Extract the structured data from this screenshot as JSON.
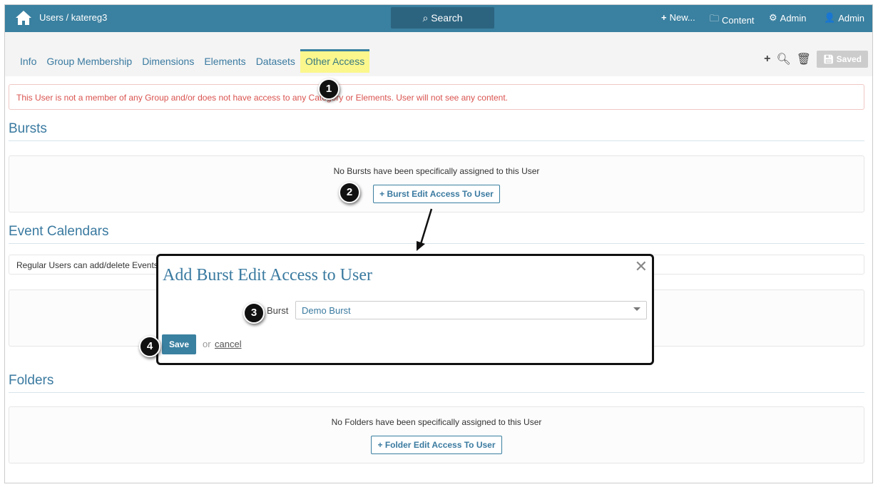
{
  "topbar": {
    "breadcrumb": "Users / katereg3",
    "search": "Search",
    "new": "New...",
    "content": "Content",
    "admin_settings": "Admin",
    "user": "Admin"
  },
  "tabs": [
    "Info",
    "Group Membership",
    "Dimensions",
    "Elements",
    "Datasets",
    "Other Access"
  ],
  "toolbar": {
    "saved": "Saved"
  },
  "alert": "This User is not a member of any Group and/or does not have access to any Category or Elements. User will not see any content.",
  "bursts": {
    "title": "Bursts",
    "empty": "No Bursts have been specifically assigned to this User",
    "button": "Burst Edit Access To User"
  },
  "calendars": {
    "title": "Event Calendars",
    "note": "Regular Users can add/delete Events"
  },
  "folders": {
    "title": "Folders",
    "empty": "No Folders have been specifically assigned to this User",
    "button": "Folder Edit Access To User"
  },
  "modal": {
    "title": "Add Burst Edit Access to User",
    "label": "Burst",
    "value": "Demo Burst",
    "save": "Save",
    "or": "or",
    "cancel": "cancel"
  },
  "badges": [
    "1",
    "2",
    "3",
    "4"
  ]
}
